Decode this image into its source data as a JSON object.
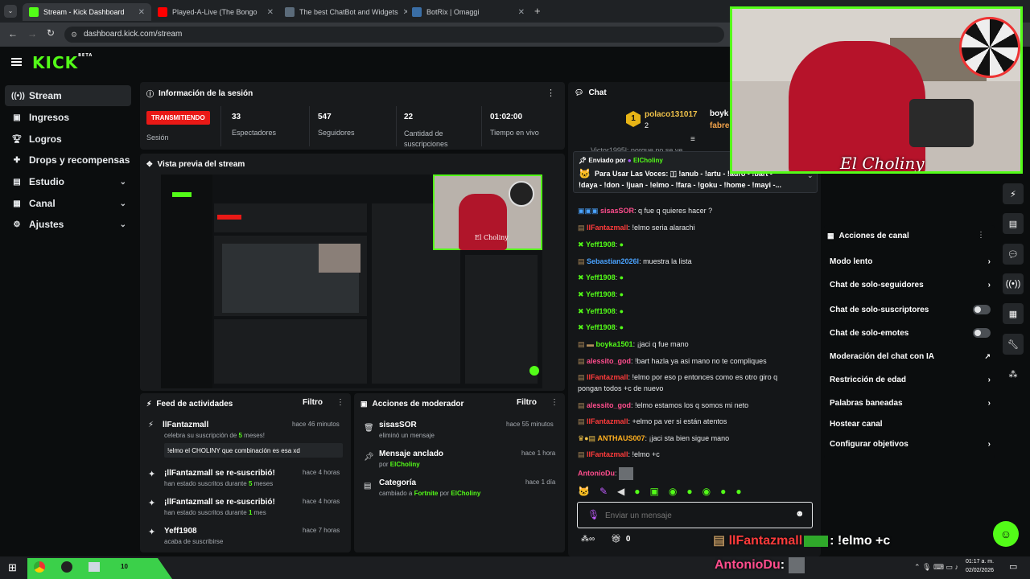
{
  "browser": {
    "tabs": [
      {
        "title": "Stream - Kick Dashboard",
        "color": "#53fc18"
      },
      {
        "title": "Played-A-Live (The Bongo",
        "color": "#ff0000"
      },
      {
        "title": "The best ChatBot and Widgets",
        "color": "#5b6b7a"
      },
      {
        "title": "BotRix | Omaggi",
        "color": "#3a6ea5"
      }
    ],
    "url": "dashboard.kick.com/stream"
  },
  "brand": {
    "logo": "KICK",
    "beta": "BETA",
    "accent": "#53fc18"
  },
  "sidebar": {
    "items": [
      {
        "label": "Stream",
        "icon": "broadcast-icon"
      },
      {
        "label": "Ingresos",
        "icon": "money-icon"
      },
      {
        "label": "Logros",
        "icon": "trophy-icon"
      },
      {
        "label": "Drops y recompensas",
        "icon": "gift-icon"
      },
      {
        "label": "Estudio",
        "icon": "studio-icon"
      },
      {
        "label": "Canal",
        "icon": "channel-icon"
      },
      {
        "label": "Ajustes",
        "icon": "gear-icon"
      }
    ]
  },
  "session": {
    "title": "Información de la sesión",
    "status": "TRANSMITIENDO",
    "status_sub": "Sesión",
    "stats": [
      {
        "value": "33",
        "label": "Espectadores"
      },
      {
        "value": "547",
        "label": "Seguidores"
      },
      {
        "value": "22",
        "label": "Cantidad de suscripciones"
      },
      {
        "value": "01:02:00",
        "label": "Tiempo en vivo"
      }
    ]
  },
  "preview": {
    "title": "Vista previa del stream",
    "overlay_name": "El Choliny"
  },
  "feed": {
    "title": "Feed de actividades",
    "filter": "Filtro",
    "items": [
      {
        "user": "llFantazmall",
        "time": "hace 46 minutos",
        "desc_pre": "celebra su suscripción de ",
        "desc_num": "5",
        "desc_post": " meses!",
        "message": "!elmo el CHOLINY que combinación es esa xd"
      },
      {
        "user": "¡llFantazmall se re-suscribió!",
        "time": "hace 4 horas",
        "desc_pre": "han estado suscritos durante ",
        "desc_num": "5",
        "desc_post": " meses"
      },
      {
        "user": "¡llFantazmall se re-suscribió!",
        "time": "hace 4 horas",
        "desc_pre": "han estado suscritos durante ",
        "desc_num": "1",
        "desc_post": " mes"
      },
      {
        "user": "Yeff1908",
        "time": "hace 7 horas",
        "desc_pre": "acaba de suscribirse",
        "desc_num": "",
        "desc_post": ""
      }
    ]
  },
  "modactions": {
    "title": "Acciones de moderador",
    "filter": "Filtro",
    "items": [
      {
        "title": "sisasSOR",
        "time": "hace 55 minutos",
        "desc_pre": "eliminó un mensaje",
        "desc_link": "",
        "desc_mid": "",
        "desc_link2": ""
      },
      {
        "title": "Mensaje anclado",
        "time": "hace 1 hora",
        "desc_pre": "por ",
        "desc_link": "ElCholiny",
        "desc_mid": "",
        "desc_link2": ""
      },
      {
        "title": "Categoría",
        "time": "hace 1 día",
        "desc_pre": "cambiado a ",
        "desc_link": "Fortnite",
        "desc_mid": " por ",
        "desc_link2": "ElCholiny"
      }
    ]
  },
  "chat": {
    "title": "Chat",
    "top_user1": "polaco131017",
    "top_user1_count": "2",
    "top_user2": "boyk",
    "top_user3": "fabre",
    "pinned_by_label": "Enviado por",
    "pinned_by": "ElCholiny",
    "pinned_text_1": "Para Usar Las Voces: 🇮 !anub - !artu - !auro - !bart -",
    "pinned_text_2": "!daya - !don - !juan - !elmo - !fara - !goku - !home - !mayi -...",
    "partial_top": "Victor1995l: porque no se ve",
    "lines": [
      {
        "user": "sisasSOR",
        "color": "#ff4d8d",
        "text": ": q fue q quieres hacer ?"
      },
      {
        "user": "llFantazmall",
        "color": "#ff3b3b",
        "text": ": !elmo seria alarachi"
      },
      {
        "user": "Yeff1908",
        "color": "#53fc18",
        "text": ":"
      },
      {
        "user": "Sebastian2026l",
        "color": "#4aa3ff",
        "text": ": muestra la lista"
      },
      {
        "user": "Yeff1908",
        "color": "#53fc18",
        "text": ":"
      },
      {
        "user": "Yeff1908",
        "color": "#53fc18",
        "text": ":"
      },
      {
        "user": "Yeff1908",
        "color": "#53fc18",
        "text": ":"
      },
      {
        "user": "Yeff1908",
        "color": "#53fc18",
        "text": ":"
      },
      {
        "user": "boyka1501",
        "color": "#53fc18",
        "text": ": ¡jaci q fue mano"
      },
      {
        "user": "alessito_god",
        "color": "#ff4d8d",
        "text": ": !bart hazla ya asi mano no te compliques"
      },
      {
        "user": "llFantazmall",
        "color": "#ff3b3b",
        "text": ": !elmo por eso p entonces como es otro giro q"
      },
      {
        "user": "",
        "color": "#e6e8ea",
        "text": "pongan todos +c de nuevo"
      },
      {
        "user": "alessito_god",
        "color": "#ff4d8d",
        "text": ": !elmo estamos los q somos mi neto"
      },
      {
        "user": "llFantazmall",
        "color": "#ff3b3b",
        "text": ": +elmo pa ver si están atentos"
      },
      {
        "user": "ANTHAUS007",
        "color": "#ffb020",
        "text": ": ¡jaci sta bien sigue mano"
      },
      {
        "user": "llFantazmall",
        "color": "#ff3b3b",
        "text": ": !elmo +c"
      },
      {
        "user": "AntonioDu",
        "color": "#ff4d8d",
        "text": ":"
      }
    ],
    "input_placeholder": "Enviar un mensaje",
    "points": "0",
    "overlay_line1_user": "llFantazmall",
    "overlay_line1_text": ": !elmo +c",
    "overlay_line2_user": "AntonioDu",
    "overlay_line2_text": ":"
  },
  "channel_actions": {
    "title": "Acciones de canal",
    "items": [
      {
        "label": "Modo lento",
        "control": "chevron"
      },
      {
        "label": "Chat de solo-seguidores",
        "control": "chevron"
      },
      {
        "label": "Chat de solo-suscriptores",
        "control": "toggle"
      },
      {
        "label": "Chat de solo-emotes",
        "control": "toggle"
      },
      {
        "label": "Moderación del chat con IA",
        "control": "external"
      },
      {
        "label": "Restricción de edad",
        "control": "chevron"
      },
      {
        "label": "Palabras baneadas",
        "control": "chevron"
      },
      {
        "label": "Hostear canal",
        "control": "none"
      },
      {
        "label": "Configurar objetivos",
        "control": "chevron"
      }
    ]
  },
  "webcam": {
    "name": "El Choliny"
  },
  "taskbar": {
    "time": "01:17 a. m.",
    "date": "02/02/2026",
    "badge": "10"
  }
}
